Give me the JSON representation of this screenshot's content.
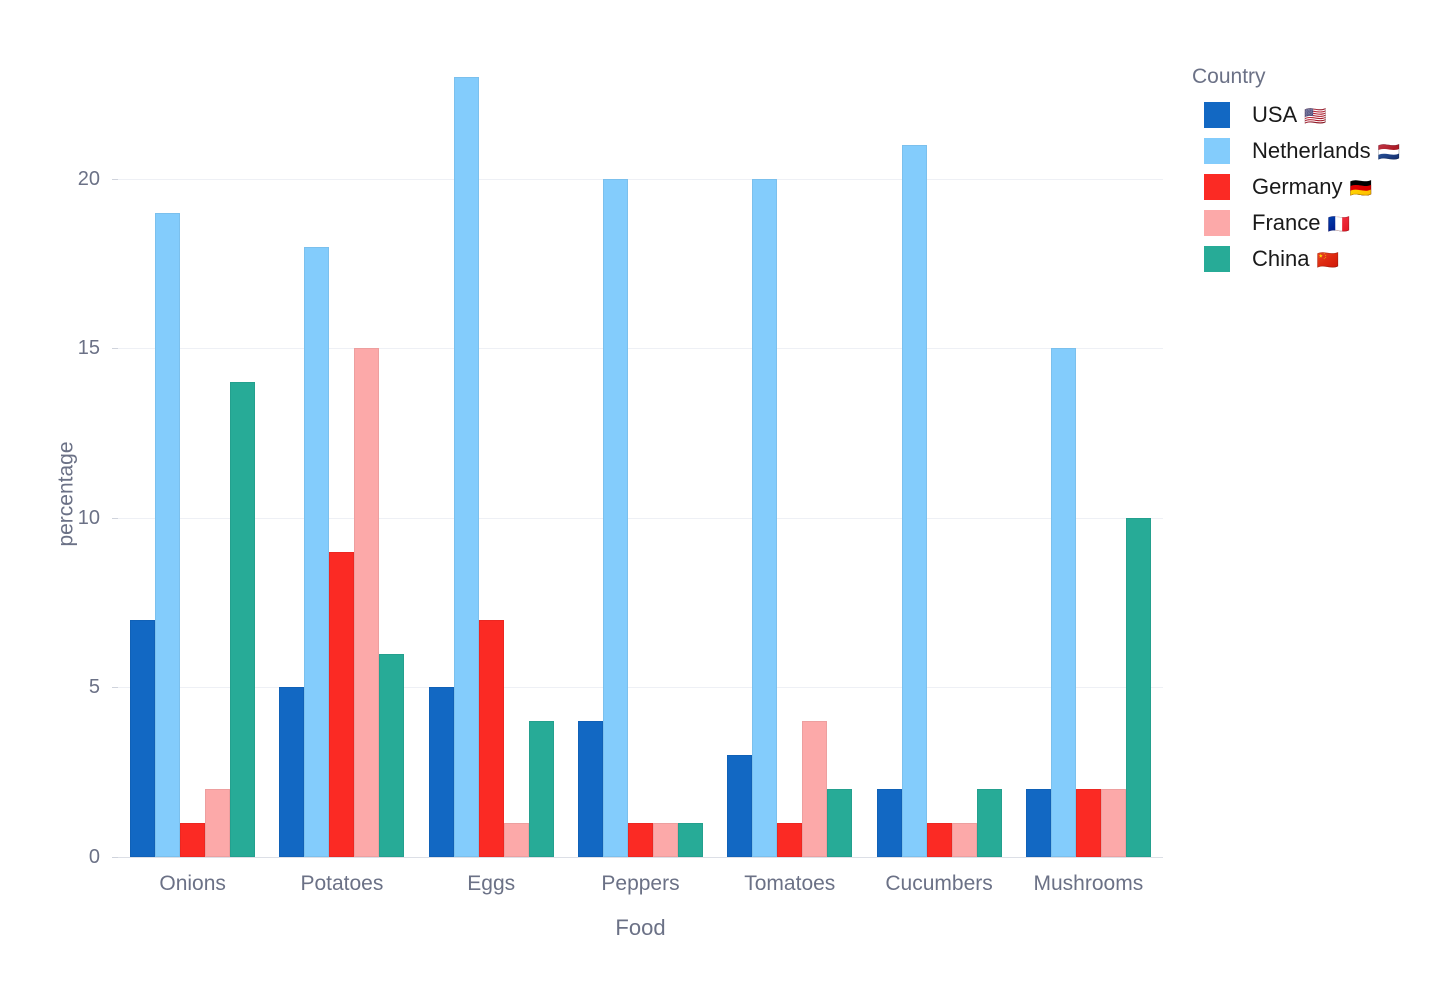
{
  "chart_data": {
    "type": "bar",
    "title": "",
    "xlabel": "Food",
    "ylabel": "percentage",
    "ylim": [
      0,
      23.5
    ],
    "yticks": [
      0,
      5,
      10,
      15,
      20
    ],
    "ytick_labels": [
      "0",
      "5",
      "10",
      "15",
      "20"
    ],
    "grid": true,
    "legend_position": "right",
    "legend_title": "Country",
    "categories": [
      "Onions",
      "Potatoes",
      "Eggs",
      "Peppers",
      "Tomatoes",
      "Cucumbers",
      "Mushrooms"
    ],
    "series": [
      {
        "name": "USA",
        "flag": "🇺🇸",
        "color": "#1268c3",
        "values": [
          7,
          5,
          5,
          4,
          3,
          2,
          2
        ]
      },
      {
        "name": "Netherlands",
        "flag": "🇳🇱",
        "color": "#83ccfc",
        "values": [
          19,
          18,
          23,
          20,
          20,
          21,
          15
        ]
      },
      {
        "name": "Germany",
        "flag": "🇩🇪",
        "color": "#fb2a24",
        "values": [
          1,
          9,
          7,
          1,
          1,
          1,
          2
        ]
      },
      {
        "name": "France",
        "flag": "🇫🇷",
        "color": "#fca9a9",
        "values": [
          2,
          15,
          1,
          1,
          4,
          1,
          2
        ]
      },
      {
        "name": "China",
        "flag": "🇨🇳",
        "color": "#27ab97",
        "values": [
          14,
          6,
          4,
          1,
          2,
          2,
          10
        ]
      }
    ]
  },
  "axes": {
    "y_title": "percentage",
    "x_title": "Food"
  },
  "legend": {
    "title": "Country",
    "items": [
      {
        "label": "USA",
        "flag": "🇺🇸",
        "color": "#1268c3"
      },
      {
        "label": "Netherlands",
        "flag": "🇳🇱",
        "color": "#83ccfc"
      },
      {
        "label": "Germany",
        "flag": "🇩🇪",
        "color": "#fb2a24"
      },
      {
        "label": "France",
        "flag": "🇫🇷",
        "color": "#fca9a9"
      },
      {
        "label": "China",
        "flag": "🇨🇳",
        "color": "#27ab97"
      }
    ]
  }
}
